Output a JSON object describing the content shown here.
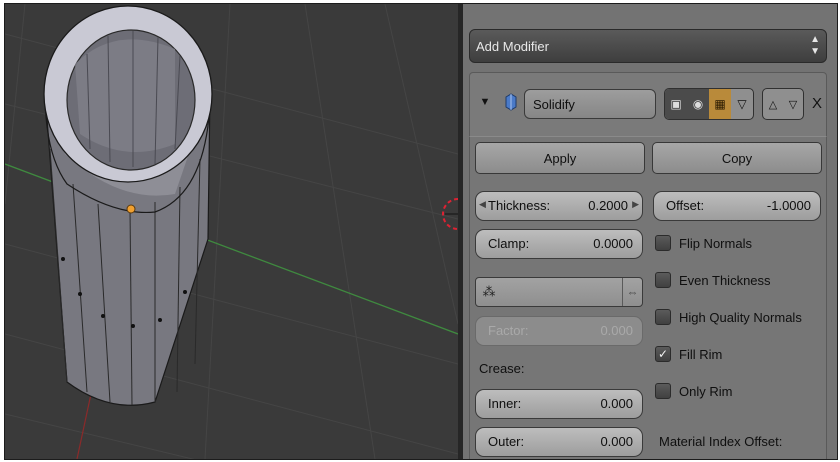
{
  "modifier_panel": {
    "add_modifier_label": "Add Modifier",
    "modifier_name": "Solidify",
    "close_glyph": "X",
    "apply_label": "Apply",
    "copy_label": "Copy",
    "thickness": {
      "label": "Thickness:",
      "value": "0.2000"
    },
    "offset": {
      "label": "Offset:",
      "value": "-1.0000"
    },
    "clamp": {
      "label": "Clamp:",
      "value": "0.0000"
    },
    "factor": {
      "label": "Factor:",
      "value": "0.000"
    },
    "crease_label": "Crease:",
    "inner": {
      "label": "Inner:",
      "value": "0.000"
    },
    "outer": {
      "label": "Outer:",
      "value": "0.000"
    },
    "material_index_offset_label": "Material Index Offset:",
    "checkboxes": [
      {
        "label": "Flip Normals",
        "checked": false
      },
      {
        "label": "Even Thickness",
        "checked": false
      },
      {
        "label": "High Quality Normals",
        "checked": false
      },
      {
        "label": "Fill Rim",
        "checked": true
      },
      {
        "label": "Only Rim",
        "checked": false
      }
    ],
    "icons": [
      "collapse-triangle-icon",
      "modifier-type-icon",
      "render-toggle-icon",
      "viewport-visibility-icon",
      "edit-mode-icon",
      "cage-icon",
      "move-up-icon",
      "move-down-icon",
      "vertex-group-icon",
      "invert-icon"
    ]
  },
  "colors": {
    "panel_bg": "#737373",
    "viewport_bg": "#3a3a3a",
    "x_axis": "#8b2a2a",
    "y_axis": "#3f8a3f",
    "selected_vertex": "#f0a030"
  }
}
